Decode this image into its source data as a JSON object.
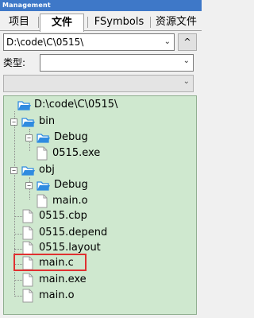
{
  "window": {
    "title": "Management"
  },
  "tabs": [
    {
      "label": "项目",
      "active": false
    },
    {
      "label": "文件",
      "active": true
    },
    {
      "label": "FSymbols",
      "active": false
    },
    {
      "label": "资源文件",
      "active": false
    }
  ],
  "path_combo": {
    "value": "D:\\code\\C\\0515\\",
    "arrow": "⌄"
  },
  "up_button": {
    "label": "^"
  },
  "type_field": {
    "label": "类型:",
    "value": "",
    "arrow": "⌄"
  },
  "filter_combo": {
    "value": "",
    "arrow": "⌄"
  },
  "file_tree": {
    "root": {
      "label": "D:\\code\\C\\0515\\"
    },
    "bin": {
      "label": "bin",
      "expander": "−"
    },
    "bin_debug": {
      "label": "Debug",
      "expander": "−"
    },
    "bin_debug_exe": {
      "label": "0515.exe"
    },
    "obj": {
      "label": "obj",
      "expander": "−"
    },
    "obj_debug": {
      "label": "Debug",
      "expander": "−"
    },
    "obj_debug_main_o": {
      "label": "main.o"
    },
    "cbp": {
      "label": "0515.cbp"
    },
    "depend": {
      "label": "0515.depend"
    },
    "layout": {
      "label": "0515.layout"
    },
    "main_c": {
      "label": "main.c"
    },
    "main_exe": {
      "label": "main.exe"
    },
    "main_o": {
      "label": "main.o"
    }
  },
  "colors": {
    "titlebar": "#3e78c8",
    "tree_background": "#cfe8cf",
    "highlight_border": "#e03030",
    "folder_blue": "#2f8be0"
  }
}
